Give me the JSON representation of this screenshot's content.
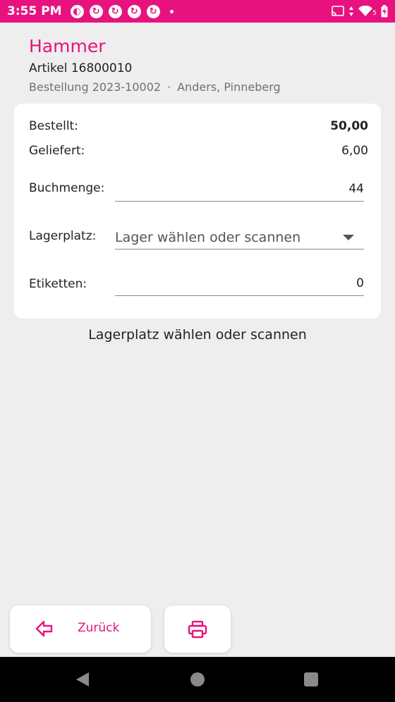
{
  "status_bar": {
    "time": "3:55 PM",
    "notification_icons": [
      "app-icon",
      "sync-icon",
      "sync-icon",
      "sync-icon",
      "sync-icon"
    ],
    "battery_level_label": "5"
  },
  "header": {
    "title": "Hammer",
    "article": "Artikel 16800010",
    "order": "Bestellung 2023-10002",
    "separator": "·",
    "customer": "Anders, Pinneberg"
  },
  "card": {
    "ordered_label": "Bestellt:",
    "ordered_value": "50,00",
    "delivered_label": "Geliefert:",
    "delivered_value": "6,00",
    "booking_qty_label": "Buchmenge:",
    "booking_qty_value": "44",
    "location_label": "Lagerplatz:",
    "location_placeholder": "Lager wählen oder scannen",
    "labels_label": "Etiketten:",
    "labels_value": "0"
  },
  "hint": "Lagerplatz wählen oder scannen",
  "buttons": {
    "back_label": "Zurück"
  },
  "colors": {
    "accent": "#e8127e",
    "background": "#eeeeee",
    "card": "#ffffff"
  }
}
